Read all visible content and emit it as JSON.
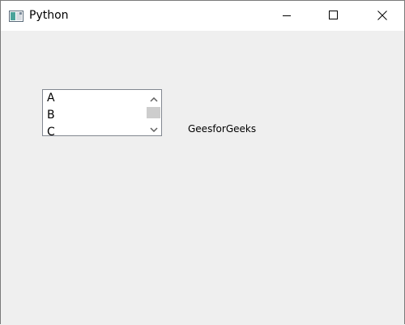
{
  "window": {
    "title": "Python",
    "icon": "python-app-icon"
  },
  "titlebar_buttons": {
    "minimize_icon": "minimize-icon",
    "maximize_icon": "maximize-icon",
    "close_icon": "close-icon"
  },
  "list": {
    "items": [
      "A",
      "B",
      "C"
    ]
  },
  "label": {
    "text": "GeesforGeeks"
  },
  "colors": {
    "client_background": "#efefef",
    "titlebar_background": "#ffffff",
    "scroll_thumb": "#cdcdcd"
  }
}
